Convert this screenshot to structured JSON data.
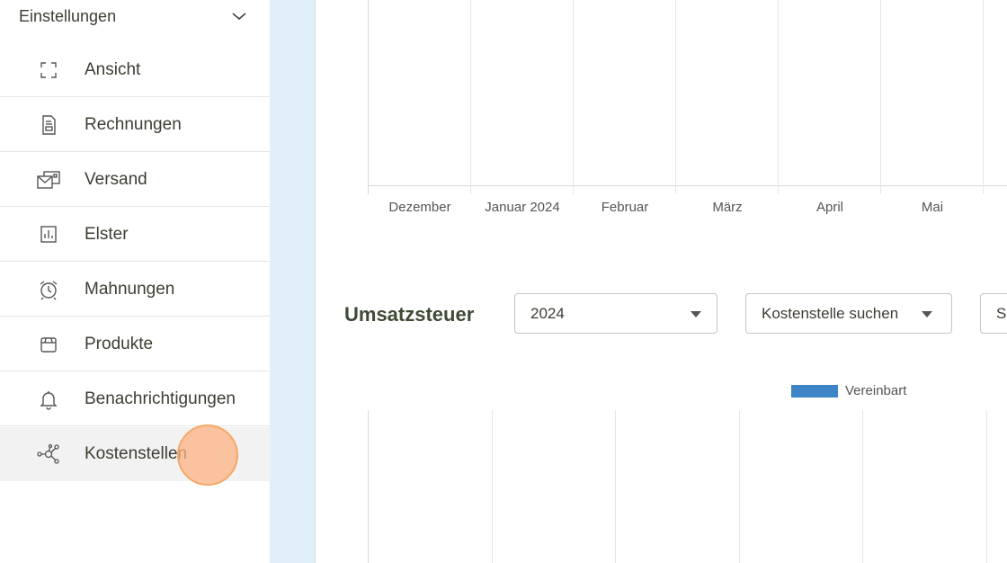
{
  "sidebar": {
    "header": "Einstellungen",
    "items": [
      {
        "label": "Ansicht",
        "icon": "fullscreen-icon"
      },
      {
        "label": "Rechnungen",
        "icon": "document-icon"
      },
      {
        "label": "Versand",
        "icon": "mail-icon"
      },
      {
        "label": "Elster",
        "icon": "bar-chart-icon"
      },
      {
        "label": "Mahnungen",
        "icon": "alarm-clock-icon"
      },
      {
        "label": "Produkte",
        "icon": "box-icon"
      },
      {
        "label": "Benachrichtigungen",
        "icon": "bell-icon"
      },
      {
        "label": "Kostenstellen",
        "icon": "network-icon"
      }
    ],
    "active_item": "Kostenstellen"
  },
  "main": {
    "top_chart_months": [
      "Dezember",
      "Januar 2024",
      "Februar",
      "März",
      "April",
      "Mai"
    ],
    "section_title": "Umsatzsteuer",
    "year_select": "2024",
    "cost_center_select": "Kostenstelle suchen",
    "third_select_partial": "S",
    "legend_label": "Vereinbart"
  },
  "colors": {
    "accent_strip": "#e1f0f8",
    "legend_bar": "#3d85c6",
    "cursor_highlight": "#fcb282"
  }
}
